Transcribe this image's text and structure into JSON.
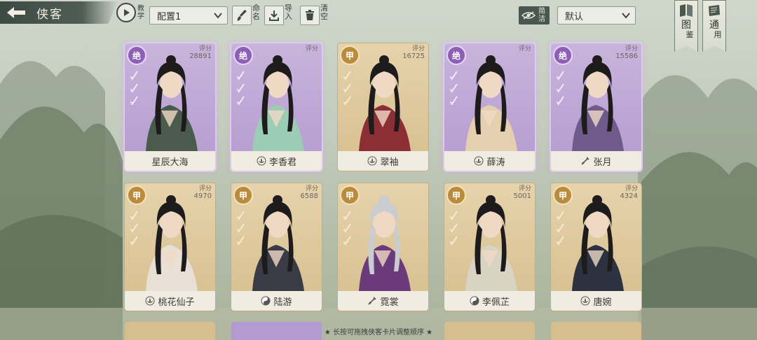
{
  "header": {
    "title": "侠客",
    "tutorial_label": "教学",
    "config_value": "配置1",
    "rename_label": "命名",
    "import_label": "导入",
    "clear_label": "清空",
    "simple_label": "简洁",
    "sort_value": "默认",
    "atlas_label_1": "图",
    "atlas_label_2": "鉴",
    "common_label_1": "通",
    "common_label_2": "用"
  },
  "cards": [
    {
      "name": "星辰大海",
      "rank": "绝",
      "score_label": "评分",
      "score": "28891",
      "tier": "jue",
      "icon": "none"
    },
    {
      "name": "李香君",
      "rank": "绝",
      "score_label": "评分",
      "score": "",
      "tier": "jue",
      "icon": "lotus"
    },
    {
      "name": "翠袖",
      "rank": "甲",
      "score_label": "评分",
      "score": "16725",
      "tier": "jia",
      "icon": "lotus"
    },
    {
      "name": "薛涛",
      "rank": "绝",
      "score_label": "评分",
      "score": "",
      "tier": "jue",
      "icon": "lotus"
    },
    {
      "name": "张月",
      "rank": "绝",
      "score_label": "评分",
      "score": "15586",
      "tier": "jue",
      "icon": "sword"
    },
    {
      "name": "桃花仙子",
      "rank": "甲",
      "score_label": "评分",
      "score": "4970",
      "tier": "jia",
      "icon": "lotus"
    },
    {
      "name": "陆游",
      "rank": "甲",
      "score_label": "评分",
      "score": "6588",
      "tier": "jia",
      "icon": "taiji"
    },
    {
      "name": "霓裳",
      "rank": "甲",
      "score_label": "",
      "score": "",
      "tier": "jia",
      "icon": "sword"
    },
    {
      "name": "李佩芷",
      "rank": "甲",
      "score_label": "评分",
      "score": "5001",
      "tier": "jia",
      "icon": "taiji"
    },
    {
      "name": "唐婉",
      "rank": "甲",
      "score_label": "评分",
      "score": "4324",
      "tier": "jia",
      "icon": "lotus"
    }
  ],
  "footer_hint": "★ 长按可拖拽侠客卡片调整顺序 ★"
}
